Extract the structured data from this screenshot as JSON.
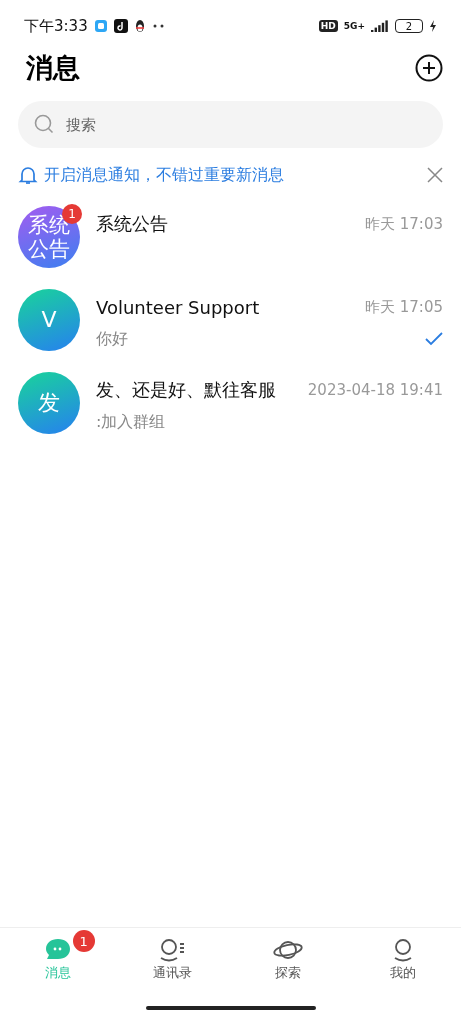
{
  "status_bar": {
    "time": "下午3:33",
    "hd": "HD",
    "network": "5G+",
    "battery": "2"
  },
  "header": {
    "title": "消息"
  },
  "search": {
    "placeholder": "搜索"
  },
  "notice": {
    "text": "开启消息通知，不错过重要新消息"
  },
  "conversations": [
    {
      "kind": "notice",
      "avatar": "系统公告",
      "name": "系统公告",
      "time": "昨天 17:03",
      "badge": "1",
      "read": false
    },
    {
      "kind": "contact",
      "avatar": "V",
      "name": "Volunteer Support",
      "time": "昨天 17:05",
      "preview": "你好",
      "read": true
    },
    {
      "kind": "contact",
      "avatar": "发",
      "name": "发、还是好、默往客服",
      "time": "2023-04-18 19:41",
      "preview": ":加入群组",
      "read": false
    }
  ],
  "tabs": [
    {
      "kind": "chat",
      "label": "消息",
      "selected": true,
      "badge": "1"
    },
    {
      "kind": "contacts",
      "label": "通讯录",
      "selected": false
    },
    {
      "kind": "explore",
      "label": "探索",
      "selected": false
    },
    {
      "kind": "me",
      "label": "我的",
      "selected": false
    }
  ]
}
